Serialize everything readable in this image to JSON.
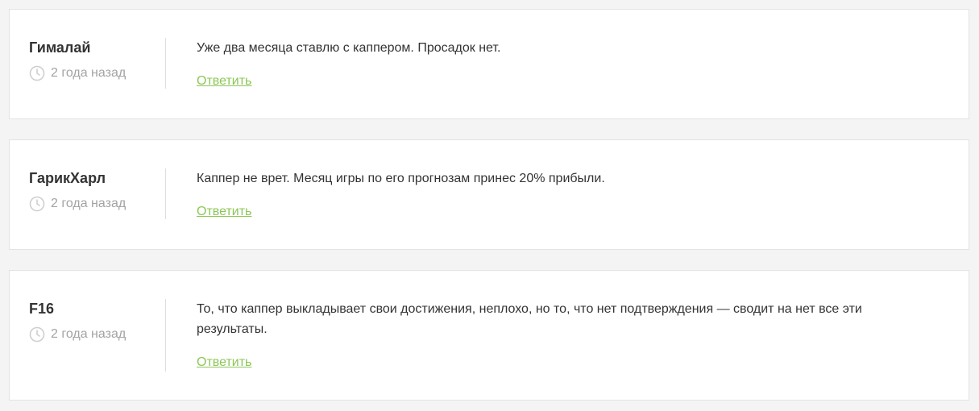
{
  "colors": {
    "page_bg": "#f4f4f4",
    "card_bg": "#ffffff",
    "reply_link": "#8cc657",
    "muted": "#a3a3a3"
  },
  "comments": [
    {
      "author": "Гималай",
      "time": "2 года назад",
      "text": "Уже два месяца ставлю с каппером. Просадок нет.",
      "reply_label": "Ответить",
      "time_icon": "clock-icon"
    },
    {
      "author": "ГарикХарл",
      "time": "2 года назад",
      "text": "Каппер не врет. Месяц игры по его прогнозам принес 20% прибыли.",
      "reply_label": "Ответить",
      "time_icon": "clock-icon"
    },
    {
      "author": "F16",
      "time": "2 года назад",
      "text": "То, что каппер выкладывает свои достижения, неплохо, но то, что нет подтверждения — сводит на нет все эти результаты.",
      "reply_label": "Ответить",
      "time_icon": "clock-icon"
    }
  ]
}
